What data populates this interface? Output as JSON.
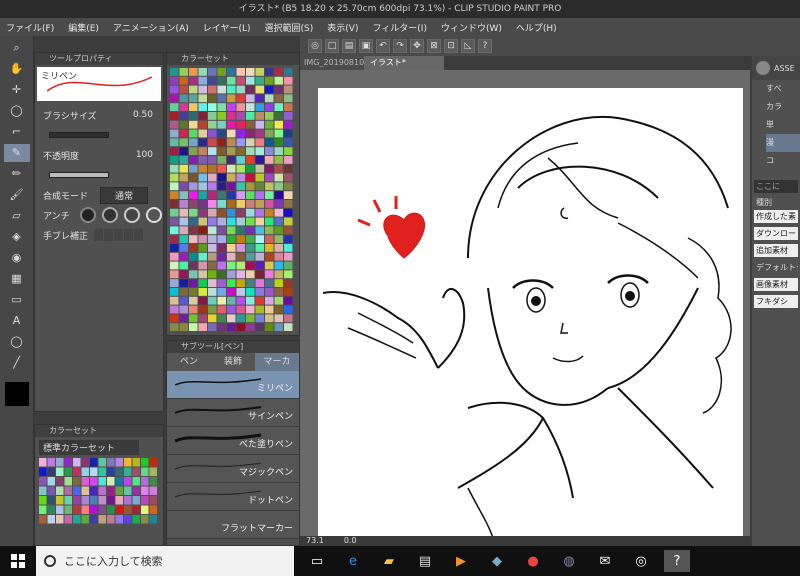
{
  "titlebar": {
    "text": "イラスト* (B5 18.20 x 25.70cm 600dpi 73.1%) - CLIP STUDIO PAINT PRO"
  },
  "menu": [
    "ファイル(F)",
    "編集(E)",
    "アニメーション(A)",
    "レイヤー(L)",
    "選択範囲(S)",
    "表示(V)",
    "フィルター(I)",
    "ウィンドウ(W)",
    "ヘルプ(H)"
  ],
  "doc_tabs": [
    "IMG_20190810",
    "イラスト*"
  ],
  "tool_property": {
    "title": "ツールプロパティ",
    "brush_name": "ミリペン",
    "brush_size_label": "ブラシサイズ",
    "brush_size_value": "0.50",
    "opacity_label": "不透明度",
    "opacity_value": "100",
    "blend_label": "合成モード",
    "blend_value": "通常",
    "aa_label": "アンチ",
    "stabilizer_label": "手ブレ補正"
  },
  "color_set_top": {
    "title": "カラーセット"
  },
  "color_set_bottom": {
    "title": "カラーセット",
    "set_name": "標準カラーセット"
  },
  "sub_tool": {
    "title": "サブツール[ペン]",
    "tabs": [
      "ペン",
      "装飾",
      "マーカ"
    ],
    "items": [
      "ミリペン",
      "サインペン",
      "べた塗りペン",
      "マジックペン",
      "ドットペン",
      "フラットマーカー"
    ]
  },
  "right_panel": {
    "assets_label": "ASSE",
    "layer_items": [
      "すべ",
      "カラ",
      "単",
      "漫",
      "コ"
    ],
    "search_placeholder": "ここに",
    "type_label": "種別",
    "buttons": [
      "作成した素",
      "ダウンロー",
      "追加素材",
      "デフォルトタ",
      "画像素材",
      "フキダシ"
    ]
  },
  "canvas": {
    "zoom": "73.1",
    "pos": "0.0"
  },
  "taskbar": {
    "search_placeholder": "ここに入力して検索"
  },
  "colors": {
    "accent": "#7a93b0",
    "heart": "#e0211d"
  }
}
